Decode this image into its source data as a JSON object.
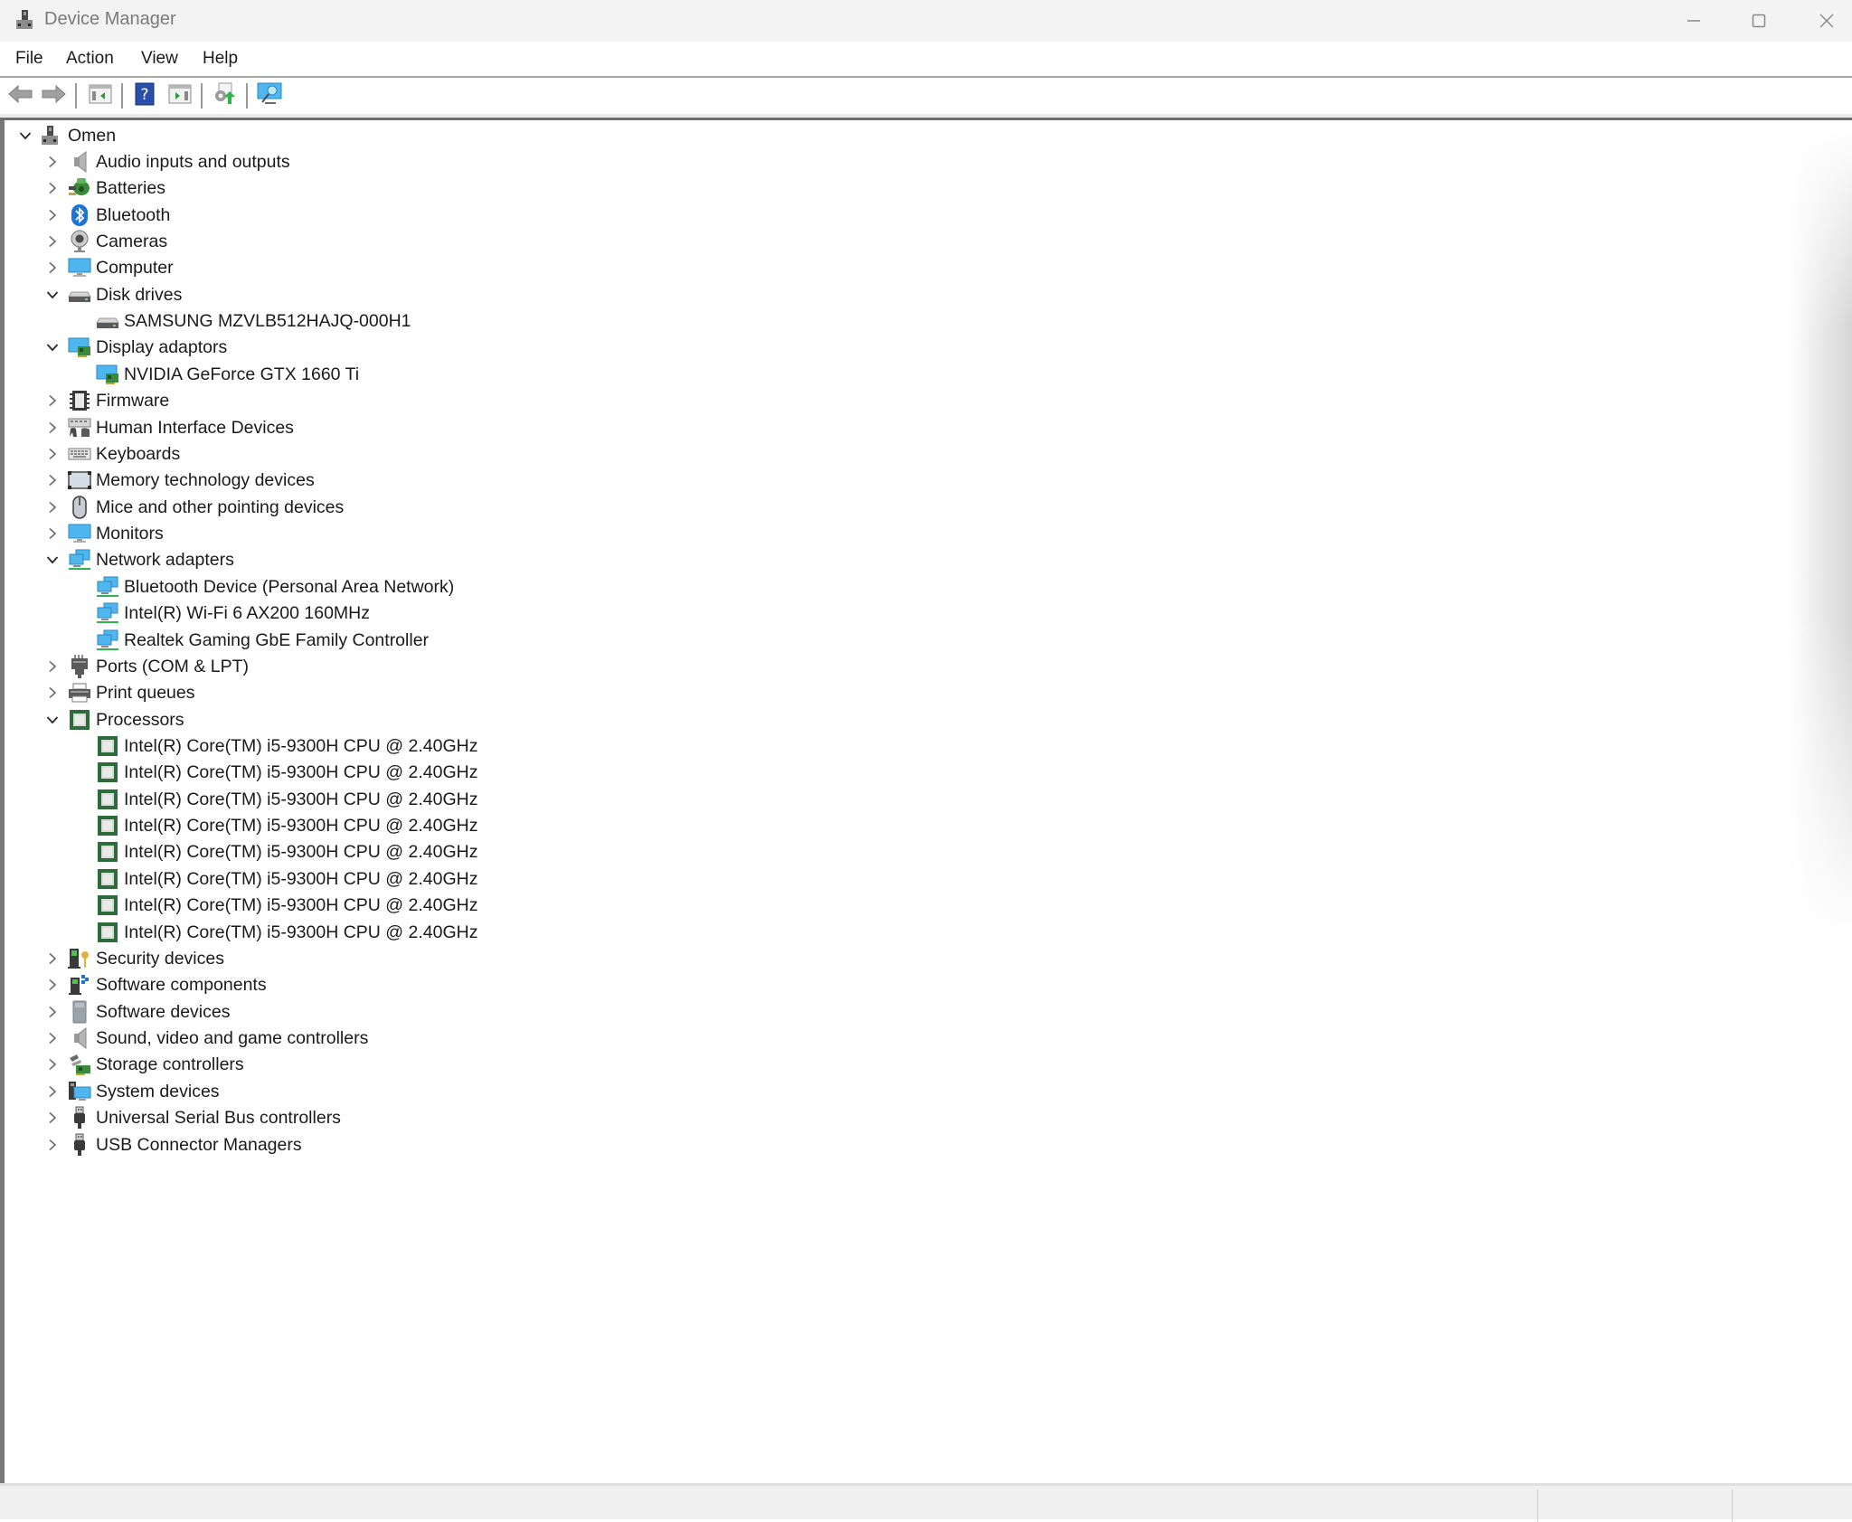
{
  "window": {
    "title": "Device Manager",
    "controls": {
      "minimize": "minimize",
      "maximize": "maximize",
      "close": "close"
    }
  },
  "menu": [
    {
      "label": "File"
    },
    {
      "label": "Action"
    },
    {
      "label": "View"
    },
    {
      "label": "Help"
    }
  ],
  "toolbar": [
    {
      "name": "back-button",
      "icon": "back-arrow-icon"
    },
    {
      "name": "forward-button",
      "icon": "forward-arrow-icon"
    },
    {
      "name": "show-hide-console-tree-button",
      "icon": "console-tree-icon"
    },
    {
      "name": "help-button",
      "icon": "help-icon"
    },
    {
      "name": "show-hide-action-pane-button",
      "icon": "action-pane-icon"
    },
    {
      "name": "update-driver-button",
      "icon": "update-driver-icon"
    },
    {
      "name": "scan-hardware-changes-button",
      "icon": "scan-monitor-icon"
    }
  ],
  "tree": {
    "root": {
      "label": "Omen",
      "icon": "computer-tower-icon",
      "expanded": true
    },
    "categories": [
      {
        "label": "Audio inputs and outputs",
        "icon": "speaker-icon",
        "expanded": false,
        "children": []
      },
      {
        "label": "Batteries",
        "icon": "battery-plug-icon",
        "expanded": false,
        "children": []
      },
      {
        "label": "Bluetooth",
        "icon": "bluetooth-icon",
        "expanded": false,
        "children": []
      },
      {
        "label": "Cameras",
        "icon": "webcam-icon",
        "expanded": false,
        "children": []
      },
      {
        "label": "Computer",
        "icon": "monitor-icon",
        "expanded": false,
        "children": []
      },
      {
        "label": "Disk drives",
        "icon": "disk-drive-icon",
        "expanded": true,
        "children": [
          {
            "label": "SAMSUNG MZVLB512HAJQ-000H1",
            "icon": "disk-drive-icon"
          }
        ]
      },
      {
        "label": "Display adaptors",
        "icon": "display-adapter-icon",
        "expanded": true,
        "children": [
          {
            "label": "NVIDIA GeForce GTX 1660 Ti",
            "icon": "display-adapter-icon"
          }
        ]
      },
      {
        "label": "Firmware",
        "icon": "chip-icon",
        "expanded": false,
        "children": []
      },
      {
        "label": "Human Interface Devices",
        "icon": "hid-icon",
        "expanded": false,
        "children": []
      },
      {
        "label": "Keyboards",
        "icon": "keyboard-icon",
        "expanded": false,
        "children": []
      },
      {
        "label": "Memory technology devices",
        "icon": "memory-card-icon",
        "expanded": false,
        "children": []
      },
      {
        "label": "Mice and other pointing devices",
        "icon": "mouse-icon",
        "expanded": false,
        "children": []
      },
      {
        "label": "Monitors",
        "icon": "monitor-icon",
        "expanded": false,
        "children": []
      },
      {
        "label": "Network adapters",
        "icon": "network-adapter-icon",
        "expanded": true,
        "children": [
          {
            "label": "Bluetooth Device (Personal Area Network)",
            "icon": "network-adapter-icon"
          },
          {
            "label": "Intel(R) Wi-Fi 6 AX200 160MHz",
            "icon": "network-adapter-icon"
          },
          {
            "label": "Realtek Gaming GbE Family Controller",
            "icon": "network-adapter-icon"
          }
        ]
      },
      {
        "label": "Ports (COM & LPT)",
        "icon": "port-icon",
        "expanded": false,
        "children": []
      },
      {
        "label": "Print queues",
        "icon": "printer-icon",
        "expanded": false,
        "children": []
      },
      {
        "label": "Processors",
        "icon": "processor-icon",
        "expanded": true,
        "children": [
          {
            "label": "Intel(R) Core(TM) i5-9300H CPU @ 2.40GHz",
            "icon": "processor-icon"
          },
          {
            "label": "Intel(R) Core(TM) i5-9300H CPU @ 2.40GHz",
            "icon": "processor-icon"
          },
          {
            "label": "Intel(R) Core(TM) i5-9300H CPU @ 2.40GHz",
            "icon": "processor-icon"
          },
          {
            "label": "Intel(R) Core(TM) i5-9300H CPU @ 2.40GHz",
            "icon": "processor-icon"
          },
          {
            "label": "Intel(R) Core(TM) i5-9300H CPU @ 2.40GHz",
            "icon": "processor-icon"
          },
          {
            "label": "Intel(R) Core(TM) i5-9300H CPU @ 2.40GHz",
            "icon": "processor-icon"
          },
          {
            "label": "Intel(R) Core(TM) i5-9300H CPU @ 2.40GHz",
            "icon": "processor-icon"
          },
          {
            "label": "Intel(R) Core(TM) i5-9300H CPU @ 2.40GHz",
            "icon": "processor-icon"
          }
        ]
      },
      {
        "label": "Security devices",
        "icon": "security-key-icon",
        "expanded": false,
        "children": []
      },
      {
        "label": "Software components",
        "icon": "software-component-icon",
        "expanded": false,
        "children": []
      },
      {
        "label": "Software devices",
        "icon": "software-device-icon",
        "expanded": false,
        "children": []
      },
      {
        "label": "Sound, video and game controllers",
        "icon": "speaker-icon",
        "expanded": false,
        "children": []
      },
      {
        "label": "Storage controllers",
        "icon": "storage-controller-icon",
        "expanded": false,
        "children": []
      },
      {
        "label": "System devices",
        "icon": "system-devices-icon",
        "expanded": false,
        "children": []
      },
      {
        "label": "Universal Serial Bus controllers",
        "icon": "usb-plug-icon",
        "expanded": false,
        "children": []
      },
      {
        "label": "USB Connector Managers",
        "icon": "usb-plug-icon",
        "expanded": false,
        "children": []
      }
    ]
  },
  "statusbar": {
    "panes": [
      "",
      "",
      ""
    ]
  },
  "colors": {
    "titlebar_bg": "#f3f3f3",
    "title_text": "#7a7a7a",
    "statusbar_bg": "#f0f0f0",
    "processor_green": "#2e6b3a",
    "bluetooth_blue": "#1e73d6",
    "monitor_blue": "#3aa3e3"
  }
}
